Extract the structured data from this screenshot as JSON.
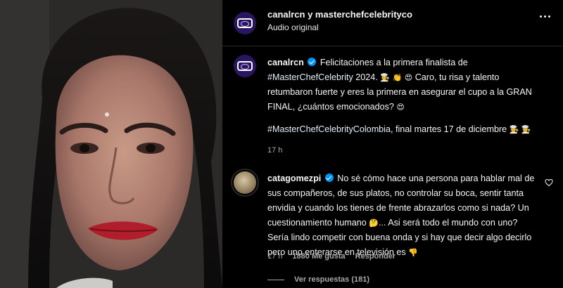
{
  "header": {
    "accounts": "canalrcn y masterchefcelebrityco",
    "audio": "Audio original"
  },
  "caption": {
    "username": "canalrcn",
    "text_a": "Felicitaciones a la primera finalista de",
    "hashtag1": "#MasterChefCelebrity",
    "text_b": "2024.",
    "text_c": "Caro, tu risa y talento retumbaron fuerte y eres la primera en asegurar el cupo a la GRAN FINAL, ¿cuántos emocionados?",
    "hashtag2": "#MasterChefCelebrityColombia",
    "text_d": ", final martes 17 de diciembre",
    "emoji_chef": "👩‍🍳",
    "emoji_clap": "👏",
    "emoji_heart_eyes": "😍",
    "time": "17 h"
  },
  "comment": {
    "username": "catagomezpi",
    "text": "No sé cómo hace una persona para hablar mal de sus compañeros, de sus platos, no controlar su boca, sentir tanta envidia y cuando los tienes de frente abrazarlos como si nada? Un cuestionamiento humano",
    "text_b": "... Asi será todo el mundo con uno? Sería lindo competir con buena onda y si hay que decir algo decirlo pero uno enterarse en televisión es",
    "emoji_thinking": "🤔",
    "emoji_down": "👎",
    "time": "17 h",
    "likes": "1880 Me gusta",
    "reply": "Responder",
    "view_replies": "Ver respuestas (181)"
  },
  "icons": {
    "more": "more-horizontal-icon",
    "like": "heart-icon",
    "verified": "verified-badge-icon"
  },
  "colors": {
    "background": "#000000",
    "muted": "#a8a8a8",
    "verified": "#0095f6",
    "divider": "#262626"
  }
}
